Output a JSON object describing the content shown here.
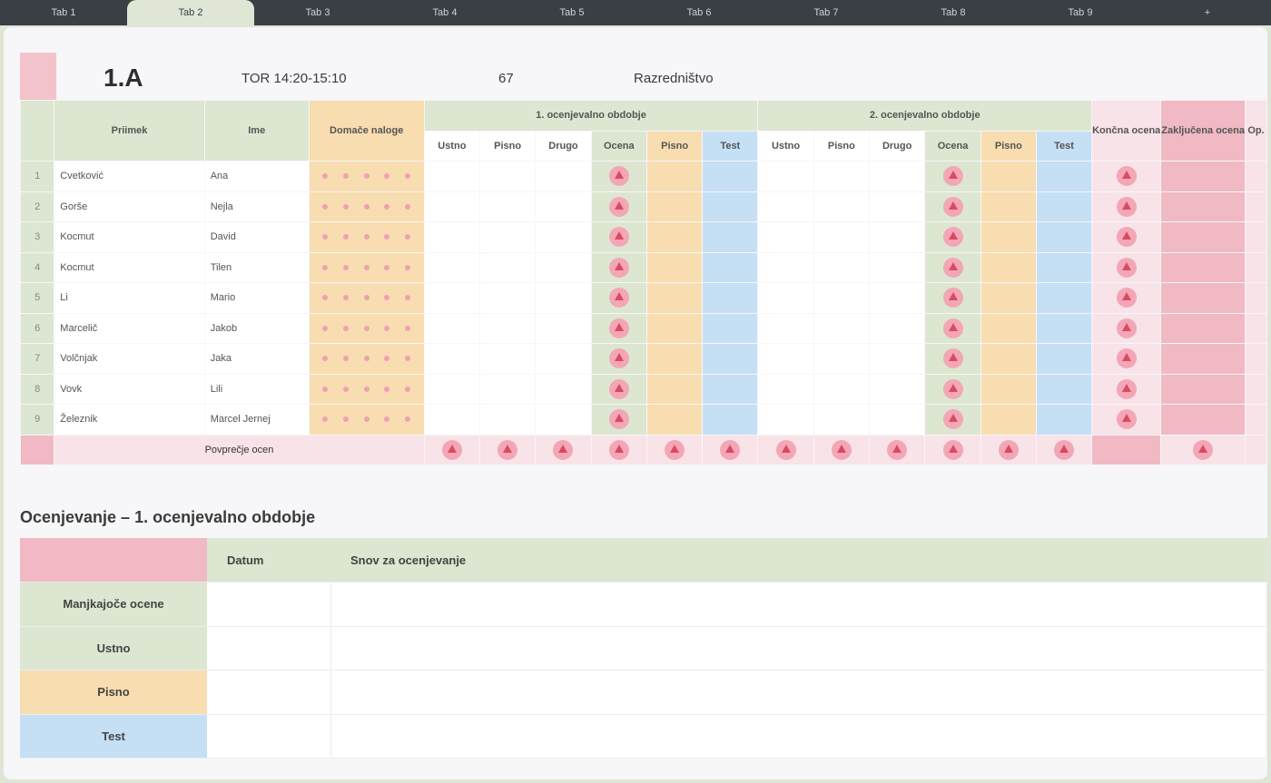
{
  "tabs": [
    "Tab 1",
    "Tab 2",
    "Tab 3",
    "Tab 4",
    "Tab 5",
    "Tab 6",
    "Tab 7",
    "Tab 8",
    "Tab 9",
    "+"
  ],
  "header": {
    "class_name": "1.A",
    "time": "TOR 14:20-15:10",
    "room": "67",
    "subject": "Razredništvo"
  },
  "table": {
    "col_surname": "Priimek",
    "col_name": "Ime",
    "col_notes": "Domače naloge",
    "period1": "1. ocenjevalno obdobje",
    "period2": "2. ocenjevalno obdobje",
    "sub_headers": [
      "Ustno",
      "Pisno",
      "Drugo"
    ],
    "final_headers": [
      "Ocena",
      "Pisno",
      "Test"
    ],
    "final_grade": "Končna ocena",
    "zakljucena": "Zaključena ocena",
    "extra": "Op.",
    "students": [
      {
        "nr": "1",
        "surname": "Cvetković",
        "name": "Ana"
      },
      {
        "nr": "2",
        "surname": "Gorše",
        "name": "Nejla"
      },
      {
        "nr": "3",
        "surname": "Kocmut",
        "name": "David"
      },
      {
        "nr": "4",
        "surname": "Kocmut",
        "name": "Tilen"
      },
      {
        "nr": "5",
        "surname": "Li",
        "name": "Mario"
      },
      {
        "nr": "6",
        "surname": "Marcelič",
        "name": "Jakob"
      },
      {
        "nr": "7",
        "surname": "Volčnjak",
        "name": "Jaka"
      },
      {
        "nr": "8",
        "surname": "Vovk",
        "name": "Lili"
      },
      {
        "nr": "9",
        "surname": "Železnik",
        "name": "Marcel Jernej"
      }
    ],
    "footer_label": "Povprečje ocen"
  },
  "overview": {
    "title": "Ocenjevanje – 1. ocenjevalno obdobje",
    "col_date": "Datum",
    "col_note": "Snov za ocenjevanje",
    "rows": [
      "Manjkajoče ocene",
      "Ustno",
      "Pisno",
      "Test"
    ]
  },
  "colors": {
    "green": "#dde6d0",
    "orange": "#f8ddb0",
    "blue": "#c5dff5",
    "pink": "#f0b9c4",
    "warning": "#f3a7b6"
  }
}
